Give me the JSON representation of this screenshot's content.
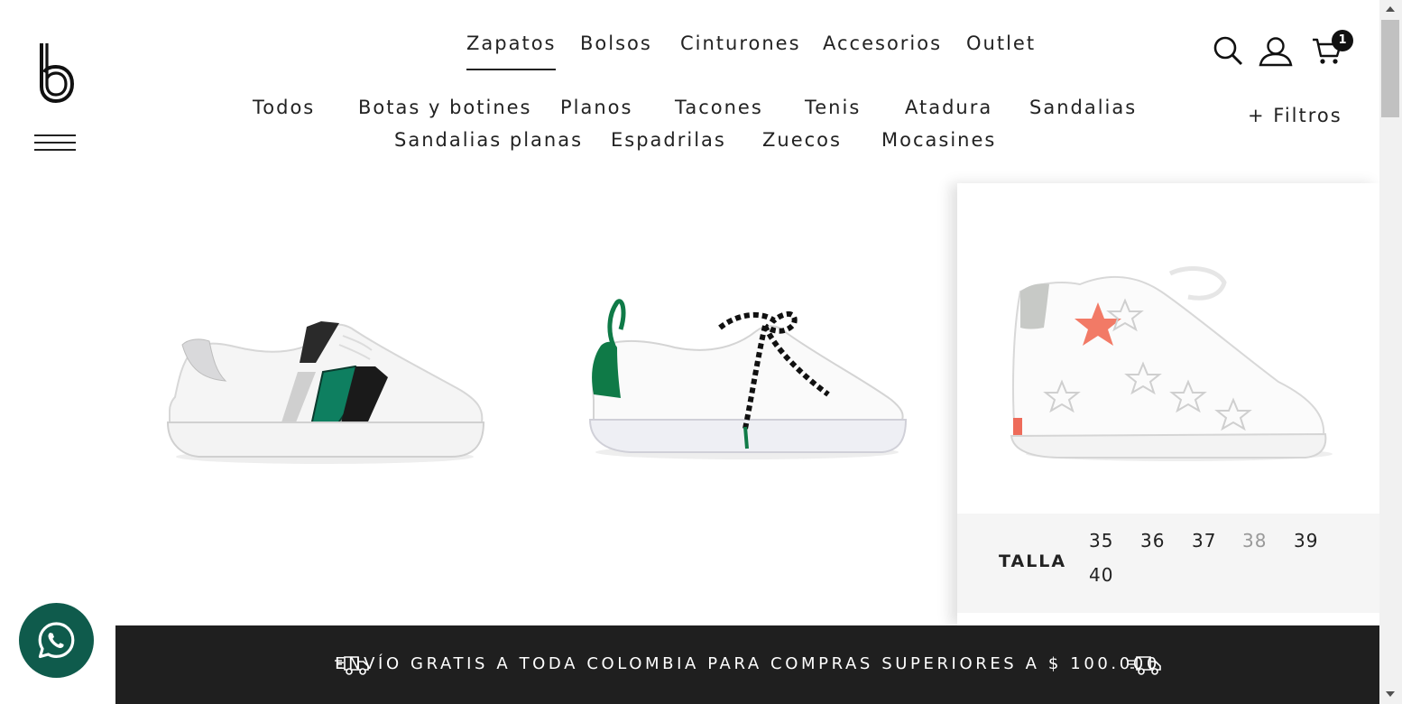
{
  "brand": {
    "logo_icon": "brand-b-logo-icon"
  },
  "header": {
    "menu_icon": "hamburger-menu-icon",
    "main_nav": [
      {
        "label": "Zapatos",
        "active": true
      },
      {
        "label": "Bolsos",
        "active": false
      },
      {
        "label": "Cinturones",
        "active": false
      },
      {
        "label": "Accesorios",
        "active": false
      },
      {
        "label": "Outlet",
        "active": false
      }
    ],
    "search_icon": "search-icon",
    "account_icon": "user-icon",
    "cart_icon": "shopping-cart-icon",
    "cart_count": "1"
  },
  "subnav": {
    "categories": [
      "Todos",
      "Botas y botines",
      "Planos",
      "Tacones",
      "Tenis",
      "Atadura",
      "Sandalias",
      "Sandalias planas",
      "Espadrilas",
      "Zuecos",
      "Mocasines"
    ],
    "filters_label": "+ Filtros"
  },
  "products": [
    {
      "name": "white-sneaker-green-python-stripe"
    },
    {
      "name": "white-sneaker-zebra-laces"
    },
    {
      "name": "white-high-top-sneaker-stars"
    }
  ],
  "size_selector": {
    "label": "TALLA",
    "sizes": [
      {
        "value": "35",
        "available": true
      },
      {
        "value": "36",
        "available": true
      },
      {
        "value": "37",
        "available": true
      },
      {
        "value": "38",
        "available": false
      },
      {
        "value": "39",
        "available": true
      },
      {
        "value": "40",
        "available": true
      }
    ]
  },
  "whatsapp": {
    "icon": "whatsapp-icon"
  },
  "shipping_banner": {
    "text": "ENVÍO GRATIS A TODA COLOMBIA PARA COMPRAS SUPERIORES A $ 100.000",
    "icon": "delivery-truck-icon"
  },
  "colors": {
    "banner_bg": "#1f1f1f",
    "whatsapp_bg": "#0f5b4c",
    "size_panel_bg": "#f5f5f5"
  }
}
